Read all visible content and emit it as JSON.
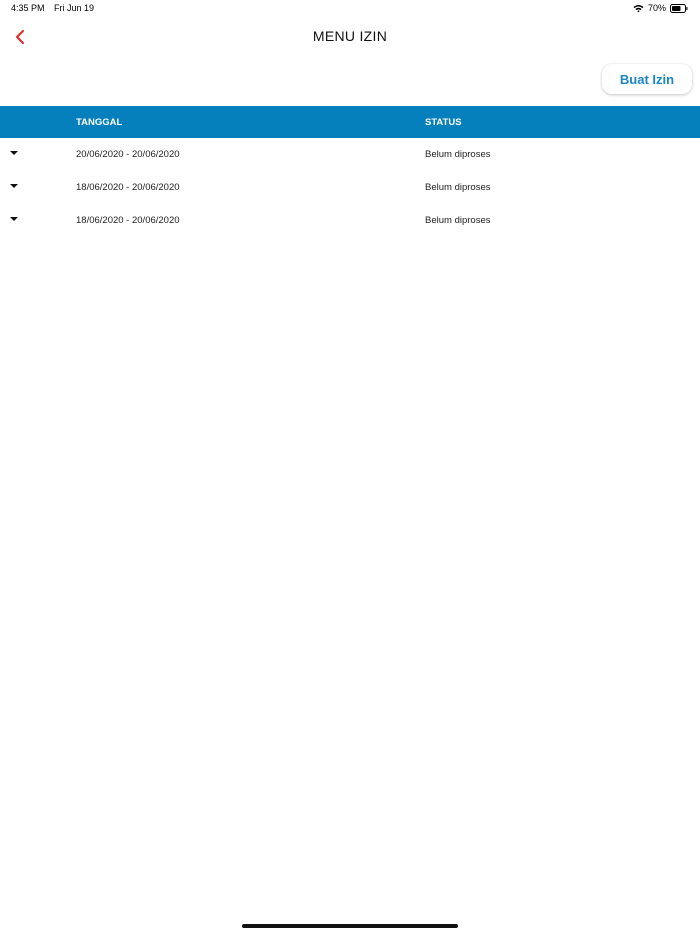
{
  "status_bar": {
    "time": "4:35 PM",
    "date": "Fri Jun 19",
    "battery": "70%",
    "icons": [
      "wifi-icon",
      "battery-icon"
    ]
  },
  "header": {
    "title": "MENU IZIN",
    "back_icon": "chevron-left-icon"
  },
  "actions": {
    "create_label": "Buat Izin"
  },
  "table": {
    "columns": {
      "date": "TANGGAL",
      "status": "STATUS"
    },
    "rows": [
      {
        "date": "20/06/2020 - 20/06/2020",
        "status": "Belum diproses"
      },
      {
        "date": "18/06/2020 - 20/06/2020",
        "status": "Belum diproses"
      },
      {
        "date": "18/06/2020 - 20/06/2020",
        "status": "Belum diproses"
      }
    ]
  },
  "colors": {
    "accent": "#0580bd",
    "button_text": "#1a86c4",
    "back_icon": "#e03131"
  }
}
